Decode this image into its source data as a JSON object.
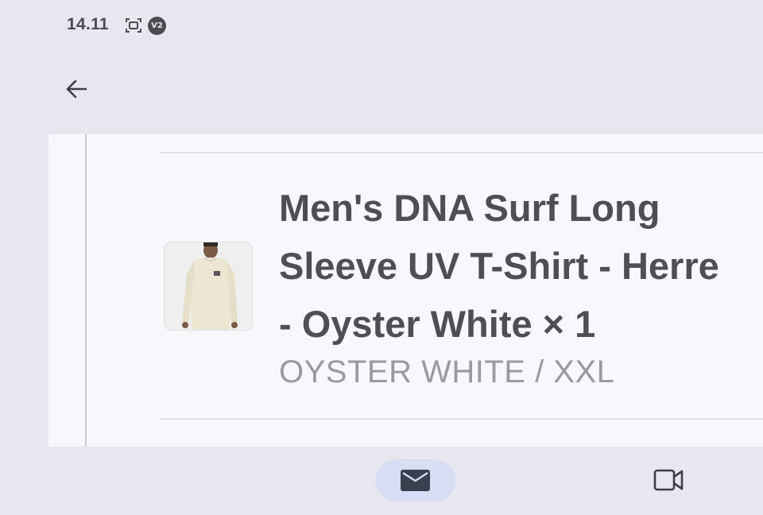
{
  "status_bar": {
    "time": "14.11",
    "icons": [
      "screenshot-icon",
      "vpn-badge-icon"
    ],
    "badge_text": "V2"
  },
  "app_bar": {
    "back_icon": "arrow-left-icon"
  },
  "order_item": {
    "title": "Men's DNA Surf Long\nSleeve UV T-Shirt - Herre\n- Oyster White × 1",
    "variant": "OYSTER WHITE / XXL",
    "image_icon": "product-thumbnail"
  },
  "bottom_nav": {
    "items": [
      {
        "icon": "mail-icon",
        "selected": true
      },
      {
        "icon": "video-camera-icon",
        "selected": false
      }
    ]
  },
  "colors": {
    "background": "#e8e7f0",
    "panel": "#f7f7fc",
    "title_text": "#4f4f53",
    "variant_text": "#9a9a9e",
    "nav_selected": "#d9ddf3",
    "icon_dark": "#3b4050"
  }
}
